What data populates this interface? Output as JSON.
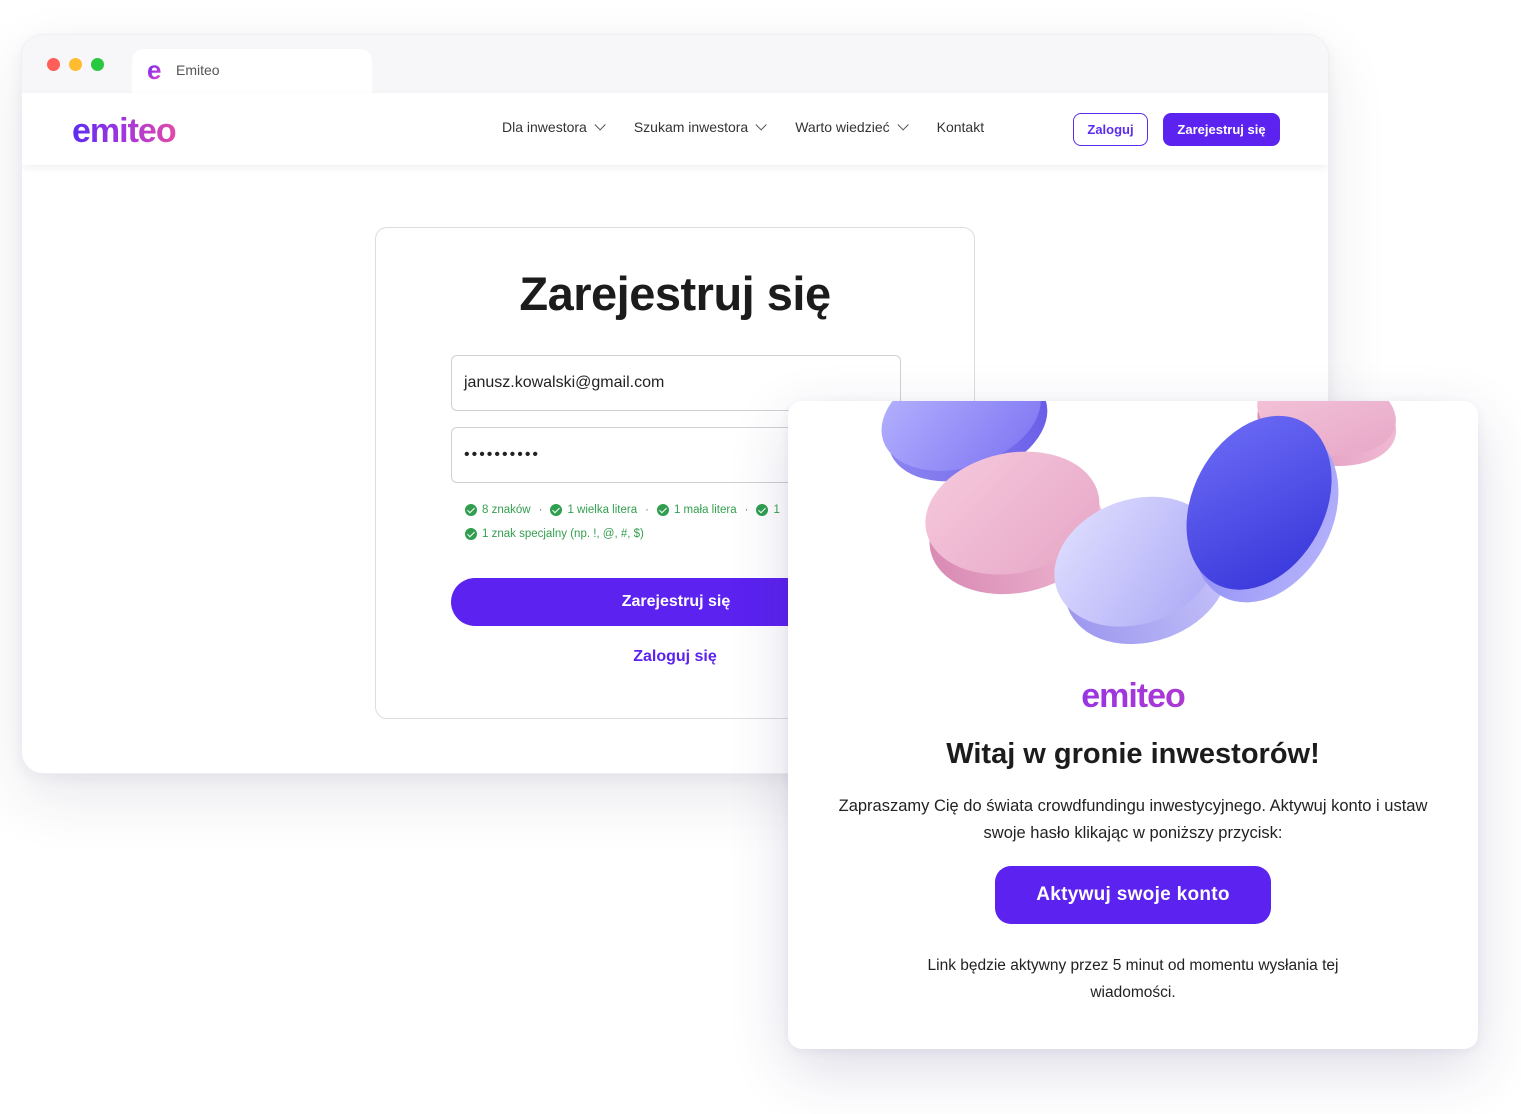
{
  "browser": {
    "tab_title": "Emiteo",
    "tab_favicon": "e"
  },
  "nav": {
    "logo": "emiteo",
    "menu": [
      {
        "label": "Dla inwestora",
        "has_dropdown": true
      },
      {
        "label": "Szukam inwestora",
        "has_dropdown": true
      },
      {
        "label": "Warto wiedzieć",
        "has_dropdown": true
      },
      {
        "label": "Kontakt",
        "has_dropdown": false
      }
    ],
    "login_label": "Zaloguj",
    "register_label": "Zarejestruj się"
  },
  "register": {
    "title": "Zarejestruj się",
    "email_value": "janusz.kowalski@gmail.com",
    "password_value": "••••••••••",
    "requirements": [
      "8 znaków",
      "1 wielka litera",
      "1 mała litera",
      "1",
      "1 znak specjalny (np. !, @, #, $)"
    ],
    "submit_label": "Zarejestruj się",
    "login_link": "Zaloguj się"
  },
  "email": {
    "logo": "emiteo",
    "title": "Witaj w gronie inwestorów!",
    "body": "Zapraszamy Cię do świata crowdfundingu inwestycyjnego. Aktywuj konto i ustaw swoje hasło klikając w poniższy przycisk:",
    "cta_label": "Aktywuj swoje konto",
    "note": "Link będzie aktywny przez 5 minut od momentu wysłania tej wiadomości."
  },
  "colors": {
    "brand_primary": "#5b22f0",
    "brand_pink": "#e24aa8",
    "success_green": "#2f9e4f"
  }
}
